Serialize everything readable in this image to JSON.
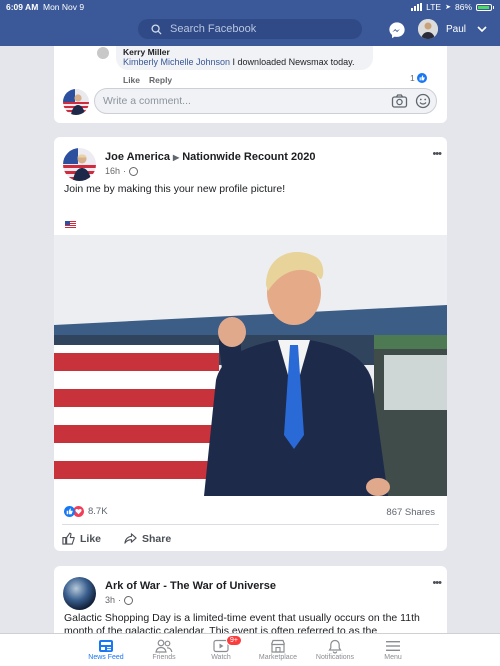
{
  "status_bar": {
    "time": "6:09 AM",
    "date": "Mon Nov 9",
    "network": "LTE",
    "battery": "86%"
  },
  "header": {
    "search_placeholder": "Search Facebook",
    "user_name": "Paul"
  },
  "comment_card": {
    "reply_author": "Kerry Miller",
    "reply_mention": "Kimberly Michelle Johnson",
    "reply_text": " I downloaded Newsmax today.",
    "like_label": "Like",
    "reply_label": "Reply",
    "reaction_count": "1",
    "write_placeholder": "Write a comment..."
  },
  "post": {
    "author": "Joe America",
    "group": "Nationwide Recount 2020",
    "time": "16h",
    "text": "Join me by making this your new profile picture!",
    "reactions_count": "8.7K",
    "shares": "867 Shares",
    "like_label": "Like",
    "share_label": "Share"
  },
  "post2": {
    "author": "Ark of War - The War of Universe",
    "time": "3h",
    "text": "Galactic Shopping Day is a limited-time event that usually occurs on the 11th month of the galactic calendar. This event is often referred to as the"
  },
  "tabs": [
    {
      "label": "News Feed",
      "icon": "news-feed-icon",
      "active": true
    },
    {
      "label": "Friends",
      "icon": "friends-icon"
    },
    {
      "label": "Watch",
      "icon": "watch-icon",
      "badge": "9+"
    },
    {
      "label": "Marketplace",
      "icon": "marketplace-icon"
    },
    {
      "label": "Notifications",
      "icon": "bell-icon"
    },
    {
      "label": "Menu",
      "icon": "menu-icon"
    }
  ],
  "colors": {
    "brand": "#3b5998",
    "accent": "#1877f2",
    "love": "#f33e58"
  }
}
